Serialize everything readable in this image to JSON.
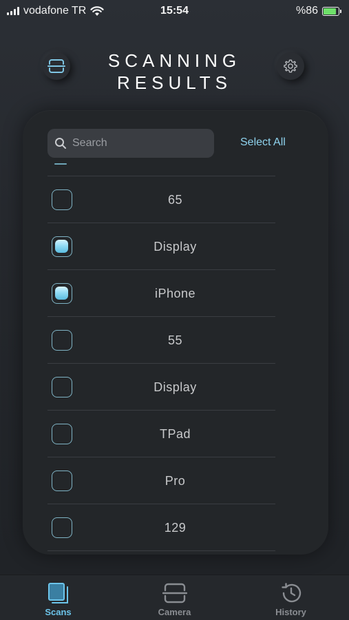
{
  "status_bar": {
    "carrier": "vodafone TR",
    "time": "15:54",
    "battery": "%86"
  },
  "header": {
    "title_line1": "SCANNING",
    "title_line2": "RESULTS",
    "left_icon": "scan-icon",
    "right_icon": "gear-icon"
  },
  "search": {
    "placeholder": "Search",
    "value": ""
  },
  "select_all_label": "Select All",
  "results": [
    {
      "label": "65",
      "checked": false
    },
    {
      "label": "Display",
      "checked": true
    },
    {
      "label": "iPhone",
      "checked": true
    },
    {
      "label": "55",
      "checked": false
    },
    {
      "label": "Display",
      "checked": false
    },
    {
      "label": "TPad",
      "checked": false
    },
    {
      "label": "Pro",
      "checked": false
    },
    {
      "label": "129",
      "checked": false
    }
  ],
  "tabs": [
    {
      "label": "Scans",
      "icon": "scans-icon",
      "active": true
    },
    {
      "label": "Camera",
      "icon": "camera-scan-icon",
      "active": false
    },
    {
      "label": "History",
      "icon": "history-icon",
      "active": false
    }
  ],
  "colors": {
    "accent": "#6cc4ea",
    "background": "#25282d",
    "card": "#232629"
  }
}
